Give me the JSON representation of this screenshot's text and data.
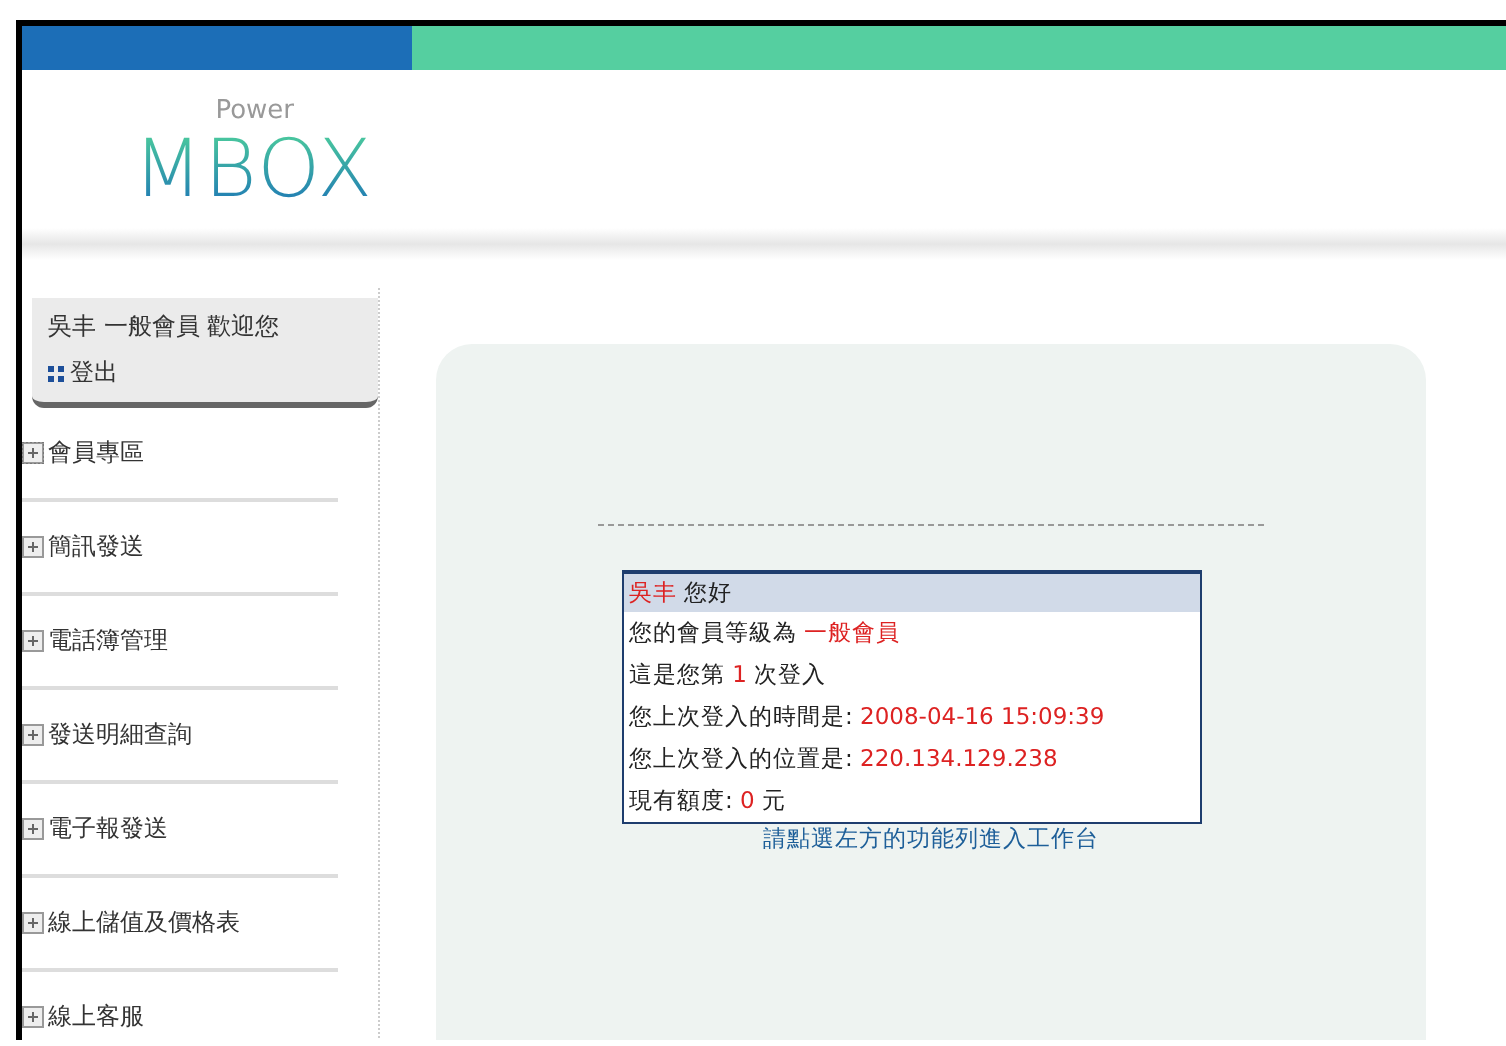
{
  "logo": {
    "small": "Power",
    "big": "MBOX"
  },
  "user_panel": {
    "welcome": "吳丰 一般會員 歡迎您",
    "logout": "登出"
  },
  "menu": [
    {
      "label": "會員專區",
      "selected": true
    },
    {
      "label": "簡訊發送",
      "selected": false
    },
    {
      "label": "電話簿管理",
      "selected": false
    },
    {
      "label": "發送明細查詢",
      "selected": false
    },
    {
      "label": "電子報發送",
      "selected": false
    },
    {
      "label": "線上儲值及價格表",
      "selected": false
    },
    {
      "label": "線上客服",
      "selected": false
    }
  ],
  "info": {
    "name": "吳丰",
    "greeting": "您好",
    "rows": [
      {
        "before": "您的會員等級為 ",
        "value": "一般會員",
        "after": ""
      },
      {
        "before": "這是您第 ",
        "value": "1",
        "after": " 次登入"
      },
      {
        "before": "您上次登入的時間是: ",
        "value": "2008-04-16 15:09:39",
        "after": ""
      },
      {
        "before": "您上次登入的位置是: ",
        "value": "220.134.129.238",
        "after": ""
      },
      {
        "before": "現有額度: ",
        "value": "0",
        "after": " 元"
      }
    ],
    "hint": "請點選左方的功能列進入工作台"
  }
}
